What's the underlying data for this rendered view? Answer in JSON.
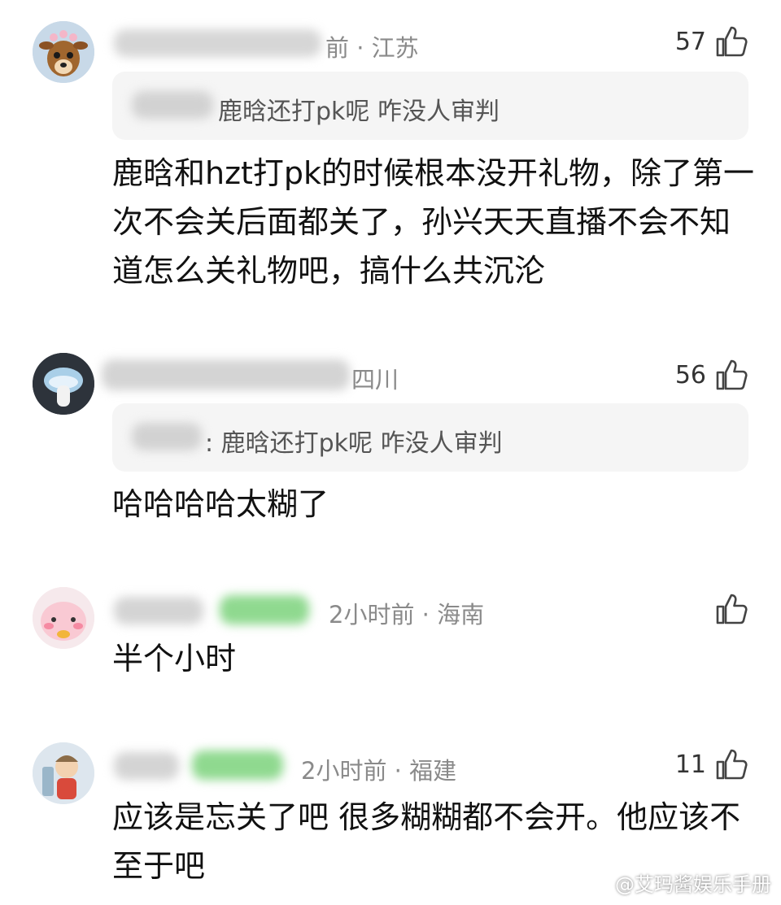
{
  "comments": [
    {
      "meta": "前 · 江苏",
      "likes": "57",
      "quote": "鹿晗还打pk呢  咋没人审判",
      "text": "鹿晗和hzt打pk的时候根本没开礼物，除了第一次不会关后面都关了，孙兴天天直播不会不知道怎么关礼物吧，搞什么共沉沦"
    },
    {
      "meta": "四川",
      "likes": "56",
      "quote": ": 鹿晗还打pk呢  咋没人审判",
      "text": "哈哈哈哈太糊了"
    },
    {
      "meta": "2小时前 · 海南",
      "likes": "",
      "text": "半个小时"
    },
    {
      "meta": "2小时前 · 福建",
      "likes": "11",
      "text": "应该是忘关了吧 很多糊糊都不会开。他应该不至于吧"
    }
  ],
  "watermark": "@艾玛酱娱乐手册",
  "icons": [
    "thumbs-up-icon",
    "avatar-deer",
    "avatar-mushroom",
    "avatar-pink-bear",
    "avatar-cartoon-boy",
    "weibo-icon"
  ]
}
